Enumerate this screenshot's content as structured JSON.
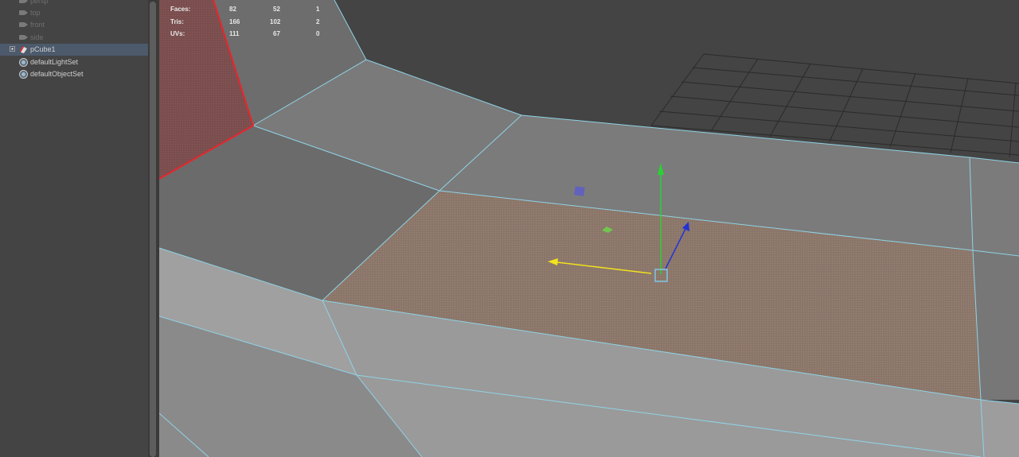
{
  "outliner": {
    "cameras": [
      {
        "label": "persp"
      },
      {
        "label": "top"
      },
      {
        "label": "front"
      },
      {
        "label": "side"
      }
    ],
    "objects": [
      {
        "label": "pCube1",
        "icon": "mesh-cube-icon",
        "selected": true
      },
      {
        "label": "defaultLightSet",
        "icon": "set-icon"
      },
      {
        "label": "defaultObjectSet",
        "icon": "set-icon"
      }
    ]
  },
  "hud": {
    "rows": [
      {
        "label": "Faces:",
        "values": [
          "82",
          "52",
          "1"
        ]
      },
      {
        "label": "Tris:",
        "values": [
          "166",
          "102",
          "2"
        ]
      },
      {
        "label": "UVs:",
        "values": [
          "111",
          "67",
          "0"
        ]
      }
    ]
  },
  "colors": {
    "viewport_bg": "#444444",
    "wire": "#8fd3e6",
    "selected_face": "#8a766a",
    "red_edge": "#e8252c",
    "move_x": "#f2e21c",
    "move_y": "#27d333",
    "move_z": "#2233d8"
  },
  "icons": [
    "camera-icon",
    "mesh-cube-icon",
    "set-icon",
    "expand-icon",
    "move-manipulator-icon"
  ]
}
